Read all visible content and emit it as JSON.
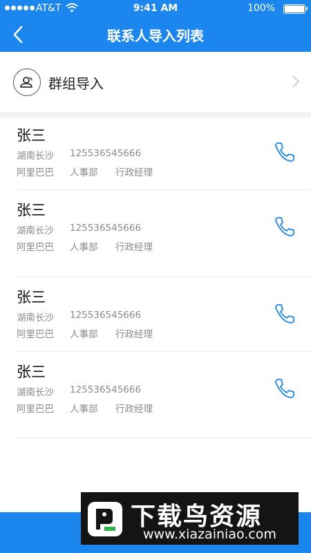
{
  "status_bar": {
    "carrier": "AT&T",
    "time": "9:41 AM",
    "battery": "100%"
  },
  "nav": {
    "title": "联系人导入列表"
  },
  "group_import": {
    "label": "群组导入"
  },
  "contacts": [
    {
      "name": "张三",
      "location": "湖南长沙",
      "phone": "125536545666",
      "company": "阿里巴巴",
      "department": "人事部",
      "position": "行政经理"
    },
    {
      "name": "张三",
      "location": "湖南长沙",
      "phone": "125536545666",
      "company": "阿里巴巴",
      "department": "人事部",
      "position": "行政经理"
    },
    {
      "name": "张三",
      "location": "湖南长沙",
      "phone": "125536545666",
      "company": "阿里巴巴",
      "department": "人事部",
      "position": "行政经理"
    },
    {
      "name": "张三",
      "location": "湖南长沙",
      "phone": "125536545666",
      "company": "阿里巴巴",
      "department": "人事部",
      "position": "行政经理"
    }
  ],
  "watermark": {
    "title": "下载鸟资源",
    "url": "www.xiazainiao.com"
  },
  "colors": {
    "primary": "#1b86ee",
    "phone_icon": "#1b86ee"
  }
}
